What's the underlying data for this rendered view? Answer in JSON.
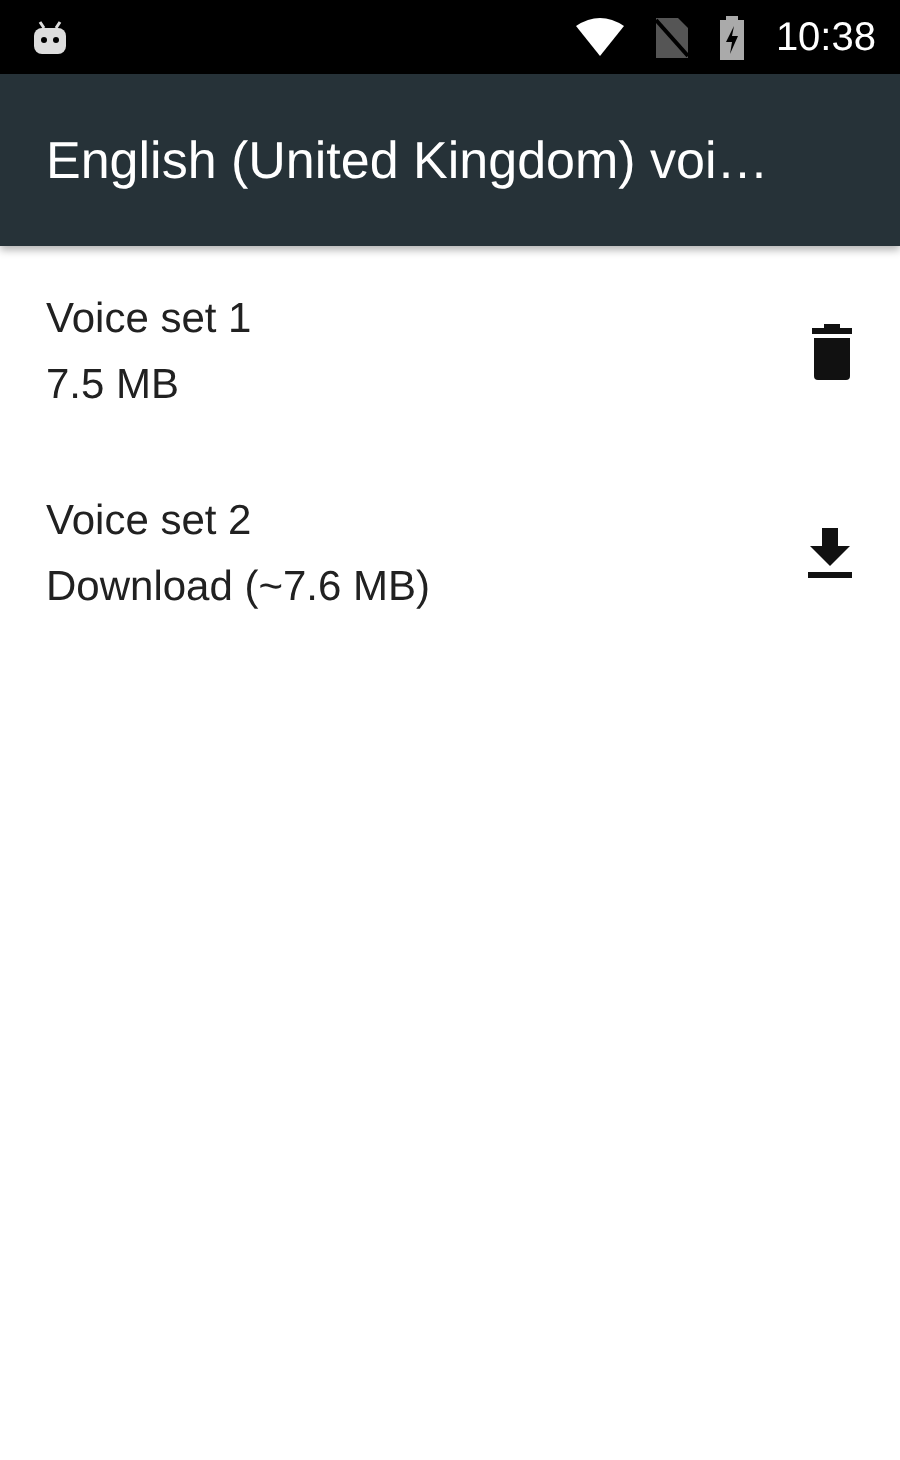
{
  "status_bar": {
    "time": "10:38"
  },
  "toolbar": {
    "title": "English (United Kingdom) voi…"
  },
  "voice_sets": [
    {
      "name": "Voice set 1",
      "detail": "7.5 MB",
      "kind": "delete"
    },
    {
      "name": "Voice set 2",
      "detail": "Download (~7.6 MB)",
      "kind": "download"
    }
  ]
}
